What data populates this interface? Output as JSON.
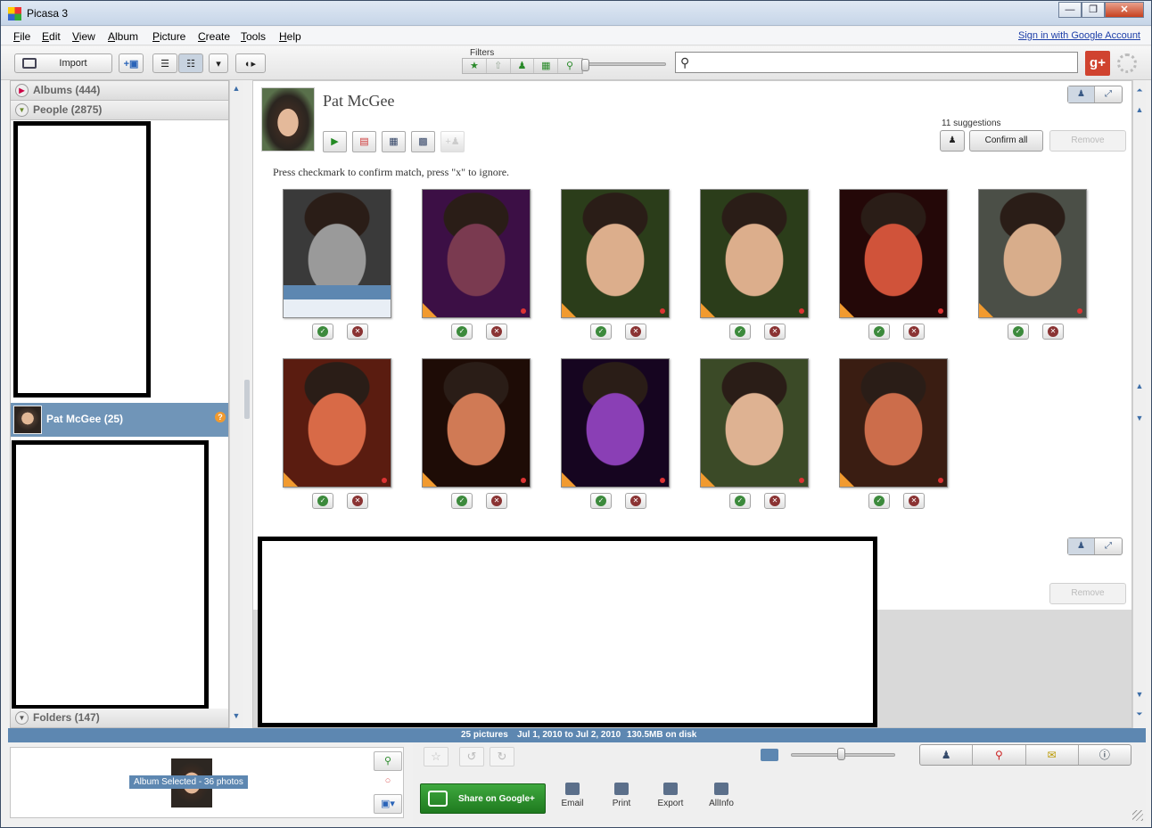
{
  "window": {
    "title": "Picasa 3",
    "controls": [
      "—",
      "❐",
      "✕"
    ]
  },
  "menu": {
    "items": [
      {
        "label": "File",
        "key": "F",
        "rest": "ile"
      },
      {
        "label": "Edit",
        "key": "E",
        "rest": "dit"
      },
      {
        "label": "View",
        "key": "V",
        "rest": "iew"
      },
      {
        "label": "Album",
        "key": "A",
        "rest": "lbum"
      },
      {
        "label": "Picture",
        "key": "P",
        "rest": "icture"
      },
      {
        "label": "Create",
        "key": "C",
        "rest": "reate"
      },
      {
        "label": "Tools",
        "key": "T",
        "rest": "ools"
      },
      {
        "label": "Help",
        "key": "H",
        "rest": "elp"
      }
    ],
    "signin": "Sign in with Google Account"
  },
  "toolbar": {
    "import_label": "Import",
    "filters_label": "Filters",
    "search_placeholder": "",
    "filter_icons": [
      "star-icon",
      "upload-icon",
      "person-icon",
      "movie-icon",
      "pin-icon"
    ]
  },
  "left": {
    "albums": "Albums (444)",
    "people": "People (2875)",
    "selected_person": "Pat McGee (25)",
    "folders": "Folders (147)"
  },
  "main": {
    "person_name": "Pat McGee",
    "suggestions": "11 suggestions",
    "confirm_all": "Confirm all",
    "remove": "Remove",
    "instruction": "Press checkmark to confirm match, press \"x\" to ignore.",
    "remove2": "Remove",
    "faces": [
      {
        "bg": "#3a3a3a",
        "skin": "#9a9a9a"
      },
      {
        "bg": "#3c0f45",
        "skin": "#7a3a50"
      },
      {
        "bg": "#2b3d1a",
        "skin": "#dcae8c"
      },
      {
        "bg": "#2b3d1a",
        "skin": "#dcae8c"
      },
      {
        "bg": "#240808",
        "skin": "#d0533a"
      },
      {
        "bg": "#4b4f47",
        "skin": "#d8ad8b"
      },
      {
        "bg": "#5a1c10",
        "skin": "#d86a47"
      },
      {
        "bg": "#1e0c06",
        "skin": "#d07a55"
      },
      {
        "bg": "#160520",
        "skin": "#8a3fb5"
      },
      {
        "bg": "#3b4a27",
        "skin": "#deb292"
      },
      {
        "bg": "#3a1d12",
        "skin": "#cc6d4b"
      }
    ]
  },
  "status": {
    "pictures": "25 pictures",
    "dates": "Jul 1, 2010 to Jul 2, 2010",
    "size": "130.5MB on disk"
  },
  "tray": {
    "label": "Album Selected - 36 photos"
  },
  "bottom": {
    "share": "Share on Google+",
    "email": "Email",
    "print": "Print",
    "export": "Export",
    "allinfo": "AllInfo"
  }
}
